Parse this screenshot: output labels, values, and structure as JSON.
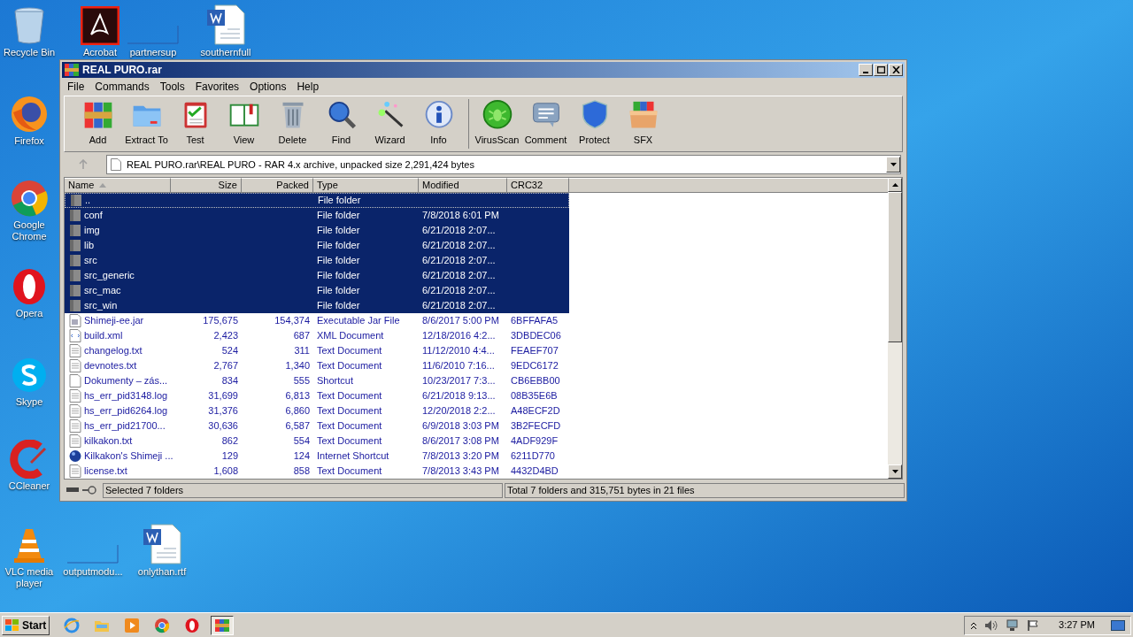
{
  "desktop_icons": [
    {
      "label": "Recycle Bin",
      "kind": "recycle"
    },
    {
      "label": "Acrobat",
      "kind": "acrobat"
    },
    {
      "label": "partnersup",
      "kind": "blank"
    },
    {
      "label": "southernfull",
      "kind": "word"
    },
    {
      "label": "Firefox",
      "kind": "firefox"
    },
    {
      "label": "Google Chrome",
      "kind": "chrome"
    },
    {
      "label": "Opera",
      "kind": "opera"
    },
    {
      "label": "Skype",
      "kind": "skype"
    },
    {
      "label": "CCleaner",
      "kind": "ccleaner"
    },
    {
      "label": "VLC media player",
      "kind": "vlc"
    },
    {
      "label": "outputmodu...",
      "kind": "blank"
    },
    {
      "label": "onlythan.rtf",
      "kind": "word"
    }
  ],
  "window": {
    "title": "REAL PURO.rar"
  },
  "menu": [
    "File",
    "Commands",
    "Tools",
    "Favorites",
    "Options",
    "Help"
  ],
  "toolbar": {
    "groups": [
      [
        {
          "label": "Add",
          "kind": "add"
        },
        {
          "label": "Extract To",
          "kind": "extract"
        },
        {
          "label": "Test",
          "kind": "test"
        },
        {
          "label": "View",
          "kind": "view"
        },
        {
          "label": "Delete",
          "kind": "delete"
        },
        {
          "label": "Find",
          "kind": "find"
        },
        {
          "label": "Wizard",
          "kind": "wizard"
        },
        {
          "label": "Info",
          "kind": "info"
        }
      ],
      [
        {
          "label": "VirusScan",
          "kind": "virus"
        },
        {
          "label": "Comment",
          "kind": "comment"
        },
        {
          "label": "Protect",
          "kind": "protect"
        },
        {
          "label": "SFX",
          "kind": "sfx"
        }
      ]
    ]
  },
  "address": {
    "up_disabled": true,
    "value": "REAL PURO.rar\\REAL PURO - RAR 4.x archive, unpacked size 2,291,424 bytes"
  },
  "table": {
    "columns": [
      "Name",
      "Size",
      "Packed",
      "Type",
      "Modified",
      "CRC32"
    ],
    "rows": [
      {
        "kind": "folder",
        "selected": true,
        "focused": true,
        "cells": [
          "..",
          "",
          "",
          "File folder",
          "",
          ""
        ]
      },
      {
        "kind": "folder",
        "selected": true,
        "focused": false,
        "cells": [
          "conf",
          "",
          "",
          "File folder",
          "7/8/2018 6:01 PM",
          ""
        ]
      },
      {
        "kind": "folder",
        "selected": true,
        "focused": false,
        "cells": [
          "img",
          "",
          "",
          "File folder",
          "6/21/2018 2:07...",
          ""
        ]
      },
      {
        "kind": "folder",
        "selected": true,
        "focused": false,
        "cells": [
          "lib",
          "",
          "",
          "File folder",
          "6/21/2018 2:07...",
          ""
        ]
      },
      {
        "kind": "folder",
        "selected": true,
        "focused": false,
        "cells": [
          "src",
          "",
          "",
          "File folder",
          "6/21/2018 2:07...",
          ""
        ]
      },
      {
        "kind": "folder",
        "selected": true,
        "focused": false,
        "cells": [
          "src_generic",
          "",
          "",
          "File folder",
          "6/21/2018 2:07...",
          ""
        ]
      },
      {
        "kind": "folder",
        "selected": true,
        "focused": false,
        "cells": [
          "src_mac",
          "",
          "",
          "File folder",
          "6/21/2018 2:07...",
          ""
        ]
      },
      {
        "kind": "folder",
        "selected": true,
        "focused": false,
        "cells": [
          "src_win",
          "",
          "",
          "File folder",
          "6/21/2018 2:07...",
          ""
        ]
      },
      {
        "kind": "jar",
        "selected": false,
        "focused": false,
        "cells": [
          "Shimeji-ee.jar",
          "175,675",
          "154,374",
          "Executable Jar File",
          "8/6/2017 5:00 PM",
          "6BFFAFA5"
        ]
      },
      {
        "kind": "xml",
        "selected": false,
        "focused": false,
        "cells": [
          "build.xml",
          "2,423",
          "687",
          "XML Document",
          "12/18/2016 4:2...",
          "3DBDEC06"
        ]
      },
      {
        "kind": "text",
        "selected": false,
        "focused": false,
        "cells": [
          "changelog.txt",
          "524",
          "311",
          "Text Document",
          "11/12/2010 4:4...",
          "FEAEF707"
        ]
      },
      {
        "kind": "text",
        "selected": false,
        "focused": false,
        "cells": [
          "devnotes.txt",
          "2,767",
          "1,340",
          "Text Document",
          "11/6/2010 7:16...",
          "9EDC6172"
        ]
      },
      {
        "kind": "shortcut",
        "selected": false,
        "focused": false,
        "cells": [
          "Dokumenty – zás...",
          "834",
          "555",
          "Shortcut",
          "10/23/2017 7:3...",
          "CB6EBB00"
        ]
      },
      {
        "kind": "text",
        "selected": false,
        "focused": false,
        "cells": [
          "hs_err_pid3148.log",
          "31,699",
          "6,813",
          "Text Document",
          "6/21/2018 9:13...",
          "08B35E6B"
        ]
      },
      {
        "kind": "text",
        "selected": false,
        "focused": false,
        "cells": [
          "hs_err_pid6264.log",
          "31,376",
          "6,860",
          "Text Document",
          "12/20/2018 2:2...",
          "A48ECF2D"
        ]
      },
      {
        "kind": "text",
        "selected": false,
        "focused": false,
        "cells": [
          "hs_err_pid21700...",
          "30,636",
          "6,587",
          "Text Document",
          "6/9/2018 3:03 PM",
          "3B2FECFD"
        ]
      },
      {
        "kind": "text",
        "selected": false,
        "focused": false,
        "cells": [
          "kilkakon.txt",
          "862",
          "554",
          "Text Document",
          "8/6/2017 3:08 PM",
          "4ADF929F"
        ]
      },
      {
        "kind": "web",
        "selected": false,
        "focused": false,
        "cells": [
          "Kilkakon's Shimeji ...",
          "129",
          "124",
          "Internet Shortcut",
          "7/8/2013 3:20 PM",
          "6211D770"
        ]
      },
      {
        "kind": "text",
        "selected": false,
        "focused": false,
        "cells": [
          "license.txt",
          "1,608",
          "858",
          "Text Document",
          "7/8/2013 3:43 PM",
          "4432D4BD"
        ]
      }
    ]
  },
  "status_bar": {
    "left": "Selected 7 folders",
    "right": "Total 7 folders and 315,751 bytes in 21 files"
  },
  "taskbar": {
    "start": "Start",
    "apps": [
      {
        "kind": "ie",
        "selected": false
      },
      {
        "kind": "explorer",
        "selected": false
      },
      {
        "kind": "media",
        "selected": false
      },
      {
        "kind": "chrome",
        "selected": false
      },
      {
        "kind": "opera",
        "selected": false
      },
      {
        "kind": "winrar",
        "selected": true
      }
    ],
    "clock": "3:27 PM"
  }
}
